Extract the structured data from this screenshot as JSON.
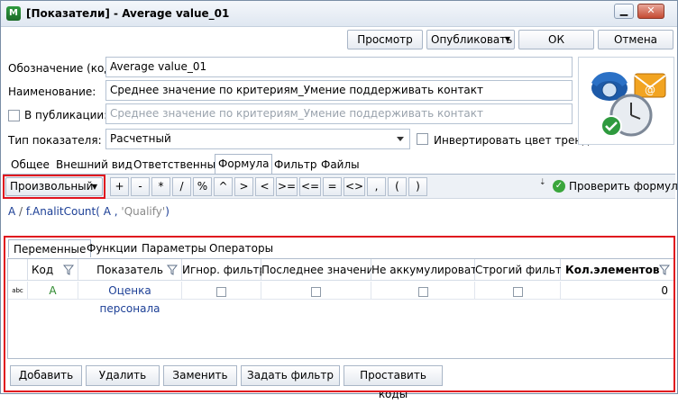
{
  "window": {
    "title": "[Показатели] - Average value_01",
    "app_icon": "M"
  },
  "toolbar": {
    "preview": "Просмотр",
    "publish": "Опубликовать",
    "ok": "ОК",
    "cancel": "Отмена"
  },
  "form": {
    "code_label": "Обозначение (код):",
    "code_value": "Average value_01",
    "name_label": "Наименование:",
    "name_value": "Среднее значение по критериям_Умение поддерживать контакт",
    "pub_label": "В публикации:",
    "pub_placeholder": "Среднее значение по критериям_Умение поддерживать контакт",
    "type_label": "Тип показателя:",
    "type_value": "Расчетный",
    "invert_label": "Инвертировать цвет тренда"
  },
  "tabs": [
    "Общее",
    "Внешний вид",
    "Ответственные",
    "Формула",
    "Фильтр",
    "Файлы"
  ],
  "formula_bar": {
    "mode": "Произвольный",
    "operators": [
      "+",
      "-",
      "*",
      "/",
      "%",
      "^",
      ">",
      "<",
      ">=",
      "<=",
      "=",
      "<>",
      ",",
      "(",
      ")"
    ],
    "check": "Проверить формулу"
  },
  "formula": {
    "a": "A",
    "op": " / ",
    "func": "f.AnalitCount(",
    "arg": " A , ",
    "str": "'Qualify'",
    "close": ")"
  },
  "panel_tabs": [
    "Переменные",
    "Функции",
    "Параметры",
    "Операторы"
  ],
  "grid": {
    "columns": [
      "Код",
      "Показатель",
      "Игнор. фильтр",
      "Последнее значение",
      "Не аккумулировать",
      "Строгий фильтр",
      "Кол.элементов"
    ],
    "rows": [
      {
        "code": "A",
        "indicator": "Оценка персонала",
        "ignore_filter": false,
        "last_value": false,
        "no_accumulate": false,
        "strict_filter": false,
        "count": "0"
      }
    ]
  },
  "bottom_buttons": [
    "Добавить",
    "Удалить",
    "Заменить",
    "Задать фильтр",
    "Проставить коды"
  ],
  "colors": {
    "accent": "#1c3f96",
    "highlight": "#e0141e"
  }
}
